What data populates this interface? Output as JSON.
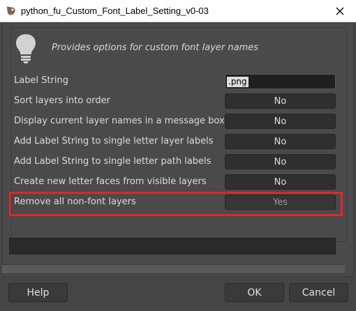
{
  "window": {
    "title": "python_fu_Custom_Font_Label_Setting_v0-03"
  },
  "description": "Provides options for custom font layer names",
  "icons": {
    "app": "gimp-app-icon",
    "close": "close-icon",
    "info": "lightbulb-icon"
  },
  "colors": {
    "highlight": "#e0262a",
    "panel": "#4a4a4a"
  },
  "fields": [
    {
      "label": "Label String",
      "value": ".png"
    },
    {
      "label": "Sort layers into order",
      "value": "No"
    },
    {
      "label": "Display current layer names in a message box",
      "value": "No"
    },
    {
      "label": "Add Label String to single letter layer labels",
      "value": "No"
    },
    {
      "label": "Add Label String to single letter path labels",
      "value": "No"
    },
    {
      "label": "Create new letter faces from visible layers",
      "value": "No"
    },
    {
      "label": "Remove all non-font layers",
      "value": "Yes"
    }
  ],
  "buttons": {
    "help": "Help",
    "ok": "OK",
    "cancel": "Cancel"
  }
}
